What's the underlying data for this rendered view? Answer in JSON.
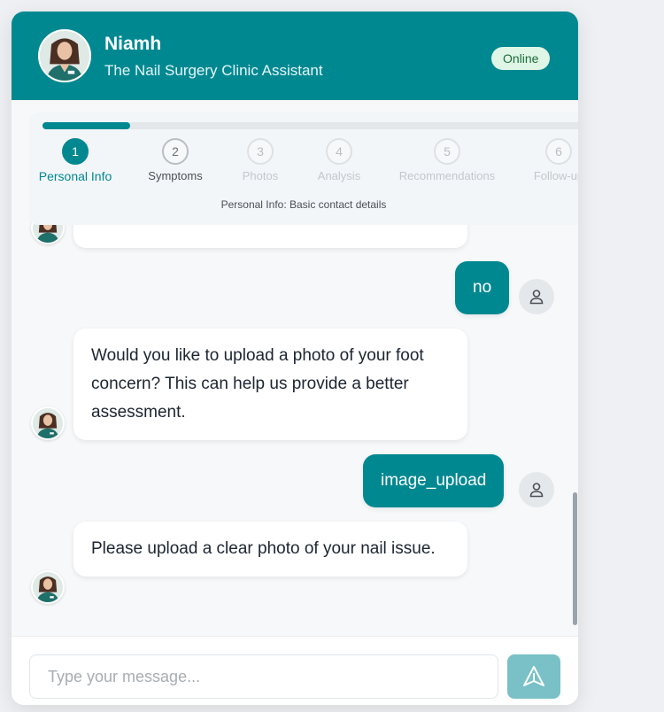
{
  "agent": {
    "name": "Niamh",
    "role": "The Nail Surgery Clinic Assistant",
    "status": "Online",
    "avatar_icon": "nurse-avatar-icon"
  },
  "progress": {
    "fraction_complete": 0.16,
    "steps": [
      {
        "number": "1",
        "label": "Personal Info",
        "state": "active"
      },
      {
        "number": "2",
        "label": "Symptoms",
        "state": "next"
      },
      {
        "number": "3",
        "label": "Photos",
        "state": "pending"
      },
      {
        "number": "4",
        "label": "Analysis",
        "state": "pending"
      },
      {
        "number": "5",
        "label": "Recommendations",
        "state": "pending"
      },
      {
        "number": "6",
        "label": "Follow-up",
        "state": "pending"
      }
    ],
    "description": "Personal Info: Basic contact details"
  },
  "messages": [
    {
      "sender": "user",
      "text": "no"
    },
    {
      "sender": "bot",
      "text": "Would you like to upload a photo of your foot concern? This can help us provide a better assessment."
    },
    {
      "sender": "user",
      "text": "image_upload"
    },
    {
      "sender": "bot",
      "text": "Please upload a clear photo of your nail issue."
    }
  ],
  "composer": {
    "placeholder": "Type your message...",
    "send_icon": "send-icon"
  },
  "colors": {
    "brand": "#008891",
    "send_button": "#79c1c6",
    "online_badge_bg": "#dff6e6",
    "page_bg": "#eef0f3"
  }
}
